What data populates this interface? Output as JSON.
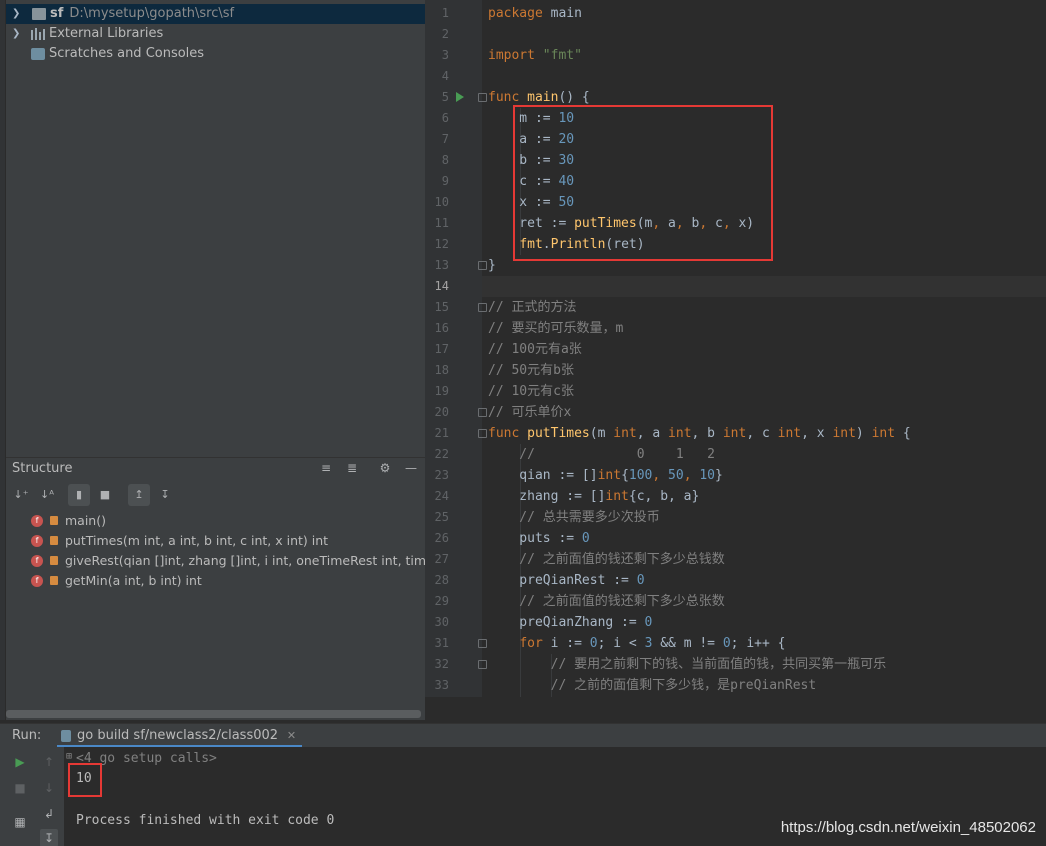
{
  "project_tree": {
    "items": [
      {
        "name": "sf",
        "path": "D:\\mysetup\\gopath\\src\\sf"
      },
      {
        "name": "External Libraries"
      },
      {
        "name": "Scratches and Consoles"
      }
    ]
  },
  "structure": {
    "title": "Structure",
    "items": [
      {
        "label": "main()"
      },
      {
        "label": "putTimes(m int, a int, b int, c int, x int) int"
      },
      {
        "label": "giveRest(qian []int, zhang []int, i int, oneTimeRest int, times int)"
      },
      {
        "label": "getMin(a int, b int) int"
      }
    ]
  },
  "editor": {
    "line_numbers": [
      "1",
      "2",
      "3",
      "4",
      "5",
      "6",
      "7",
      "8",
      "9",
      "10",
      "11",
      "12",
      "13",
      "14",
      "15",
      "16",
      "17",
      "18",
      "19",
      "20",
      "21",
      "22",
      "23",
      "24",
      "25",
      "26",
      "27",
      "28",
      "29",
      "30",
      "31",
      "32",
      "33"
    ],
    "lines": {
      "l1_kw": "package",
      "l1_txt": " main",
      "l3_kw": "import",
      "l3_str": "\"fmt\"",
      "l5_kw": "func",
      "l5_fn": "main",
      "l5_txt": "() {",
      "l6_txt": "    m := ",
      "l6_num": "10",
      "l7_txt": "    a := ",
      "l7_num": "20",
      "l8_txt": "    b := ",
      "l8_num": "30",
      "l9_txt": "    c := ",
      "l9_num": "40",
      "l10_txt": "    x := ",
      "l10_num": "50",
      "l11_a": "    ret := ",
      "l11_fn": "putTimes",
      "l11_b": "(m",
      "l11_c": ", ",
      "l11_d": "a",
      "l11_e": ", ",
      "l11_f": "b",
      "l11_g": ", ",
      "l11_h": "c",
      "l11_i": ", ",
      "l11_j": "x)",
      "l12_a": "    ",
      "l12_fn": "fmt",
      "l12_b": ".",
      "l12_fn2": "Println",
      "l12_c": "(ret)",
      "l13_txt": "}",
      "l15_cm": "// 正式的方法",
      "l16_cm": "// 要买的可乐数量，m",
      "l17_cm": "// 100元有a张",
      "l18_cm": "// 50元有b张",
      "l19_cm": "// 10元有c张",
      "l20_cm": "// 可乐单价x",
      "l21_kw": "func",
      "l21_fn": "putTimes",
      "l21_a": "(m ",
      "l21_k1": "int",
      "l21_b": ", a ",
      "l21_k2": "int",
      "l21_c": ", b ",
      "l21_k3": "int",
      "l21_d": ", c ",
      "l21_k4": "int",
      "l21_e": ", x ",
      "l21_k5": "int",
      "l21_f": ") ",
      "l21_k6": "int",
      "l21_g": " {",
      "l22_cm": "    //             0    1   2",
      "l23_a": "    qian := []",
      "l23_k": "int",
      "l23_b": "{",
      "l23_n1": "100",
      "l23_c": ", ",
      "l23_n2": "50",
      "l23_d": ", ",
      "l23_n3": "10",
      "l23_e": "}",
      "l24_a": "    zhang := []",
      "l24_k": "int",
      "l24_b": "{c, b, a}",
      "l25_cm": "    // 总共需要多少次投币",
      "l26_a": "    puts := ",
      "l26_n": "0",
      "l27_cm": "    // 之前面值的钱还剩下多少总钱数",
      "l28_a": "    preQianRest := ",
      "l28_n": "0",
      "l29_cm": "    // 之前面值的钱还剩下多少总张数",
      "l30_a": "    preQianZhang := ",
      "l30_n": "0",
      "l31_a": "    ",
      "l31_kw": "for",
      "l31_b": " i := ",
      "l31_n1": "0",
      "l31_c": "; i < ",
      "l31_n2": "3",
      "l31_d": " && m != ",
      "l31_n3": "0",
      "l31_e": "; i++ {",
      "l32_cm": "        // 要用之前剩下的钱、当前面值的钱，共同买第一瓶可乐",
      "l33_cm": "        // 之前的面值剩下多少钱，是preQianRest"
    }
  },
  "run_panel": {
    "label": "Run:",
    "tab_title": "go build sf/newclass2/class002",
    "setup_calls": "<4 go setup calls>",
    "output_value": "10",
    "finish_message": "Process finished with exit code 0"
  },
  "watermark": "https://blog.csdn.net/weixin_48502062",
  "colors": {
    "background": "#2b2b2b",
    "keyword": "#cc7832",
    "number": "#6897bb",
    "string": "#6a8759",
    "function": "#ffc66d",
    "comment": "#808080",
    "highlight_box": "#e53935"
  }
}
